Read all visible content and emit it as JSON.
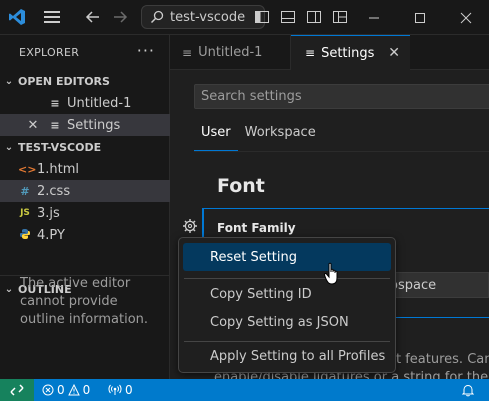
{
  "titlebar": {
    "search_label": "test-vscode"
  },
  "explorer": {
    "title": "EXPLORER",
    "more_label": "···",
    "open_editors": {
      "label": "OPEN EDITORS",
      "items": [
        {
          "label": "Untitled-1"
        },
        {
          "label": "Settings"
        }
      ]
    },
    "workspace": {
      "label": "TEST-VSCODE",
      "files": [
        {
          "label": "1.html",
          "icon": "<>",
          "color": "#e37933"
        },
        {
          "label": "2.css",
          "icon": "#",
          "color": "#519aba"
        },
        {
          "label": "3.js",
          "icon": "JS",
          "color": "#cbcb41"
        },
        {
          "label": "4.PY",
          "icon": "python",
          "color": "#3572a5"
        }
      ]
    },
    "outline": {
      "label": "OUTLINE",
      "message": "The active editor cannot provide outline information."
    }
  },
  "tabs": [
    {
      "label": "Untitled-1",
      "active": false
    },
    {
      "label": "Settings",
      "active": true
    }
  ],
  "settings": {
    "search_placeholder": "Search settings",
    "scope_tabs": [
      "User",
      "Workspace"
    ],
    "section_title": "Font",
    "setting_title": "Font Family",
    "font_value_partial": "ospace",
    "description_partial_1": "t features. Can b",
    "description_partial_2": "enable/disable ligatures or a string for the valu"
  },
  "context_menu": {
    "items": [
      "Reset Setting",
      "Copy Setting ID",
      "Copy Setting as JSON",
      "Apply Setting to all Profiles"
    ]
  },
  "statusbar": {
    "errors": "0",
    "warnings": "0",
    "ports": "0"
  },
  "colors": {
    "accent": "#0078d4",
    "statusbar": "#007acc",
    "remote": "#16825d",
    "menu_highlight": "#04395e"
  }
}
